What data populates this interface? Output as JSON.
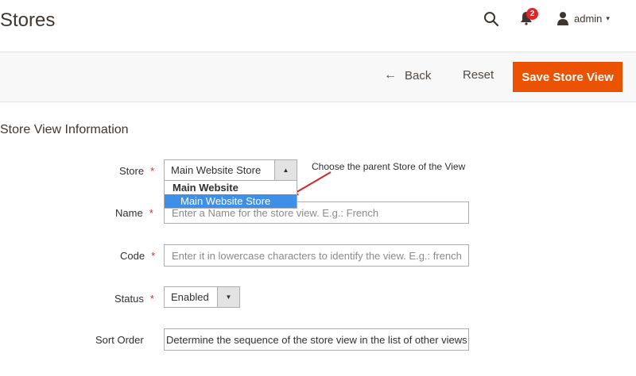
{
  "header": {
    "title": "Stores",
    "notifications_count": "2",
    "user_label": "admin",
    "user_caret": "▾"
  },
  "toolbar": {
    "back_label": "Back",
    "back_arrow": "←",
    "reset_label": "Reset",
    "save_label": "Save Store View",
    "save_color": "#eb5202"
  },
  "section": {
    "title": "Store View Information"
  },
  "form": {
    "store": {
      "label": "Store",
      "required": "*",
      "selected_value": "Main Website Store",
      "annotation": "Choose the parent Store of the View",
      "dropdown_group": "Main Website",
      "dropdown_option": "Main Website Store"
    },
    "name": {
      "label": "Name",
      "required": "*",
      "placeholder": "Enter a Name for the store view. E.g.: French"
    },
    "code": {
      "label": "Code",
      "required": "*",
      "placeholder": "Enter it in lowercase characters to identify the view. E.g.: french"
    },
    "status": {
      "label": "Status",
      "required": "*",
      "selected_value": "Enabled"
    },
    "sort_order": {
      "label": "Sort Order",
      "value": "Determine  the sequence of the store view in the list of other views"
    }
  },
  "icons": {
    "search": "search-icon",
    "bell": "bell-icon",
    "user": "user-icon",
    "select_arrow_up": "▲",
    "select_arrow_down": "▼"
  }
}
